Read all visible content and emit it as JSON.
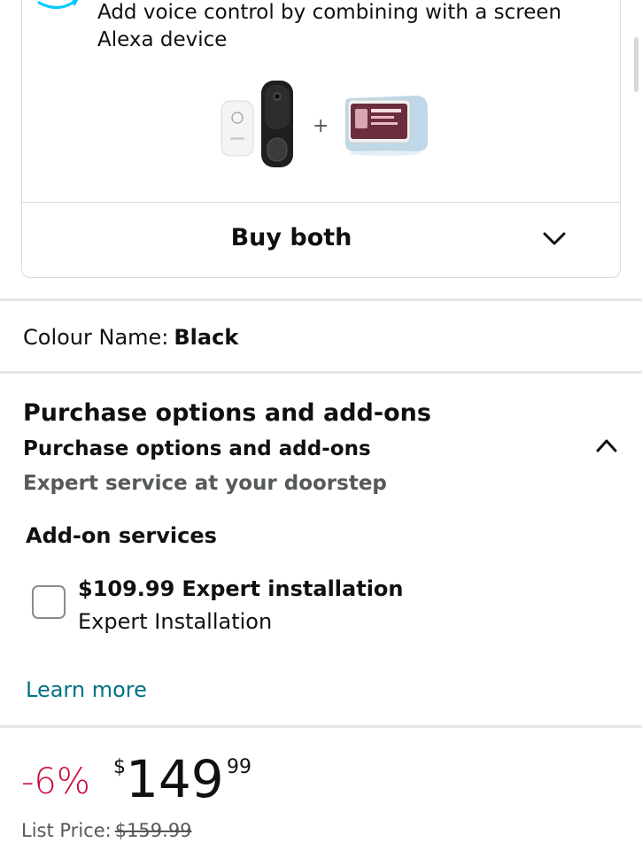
{
  "bundle": {
    "text": "Add voice control by combining with a screen Alexa device",
    "plus_sign": "+",
    "buy_both_label": "Buy both"
  },
  "colour": {
    "label": "Colour Name:",
    "value": "Black"
  },
  "purchase_options": {
    "heading": "Purchase options and add-ons",
    "subheading": "Purchase options and add-ons",
    "tagline": "Expert service at your doorstep",
    "addon_section_title": "Add-on services",
    "addon": {
      "checked": false,
      "price": "$109.99",
      "name": "Expert installation",
      "description": "Expert Installation"
    },
    "learn_more": "Learn more"
  },
  "pricing": {
    "discount": "-6%",
    "currency_symbol": "$",
    "whole": "149",
    "fraction": "99",
    "list_price_label": "List Price:",
    "list_price_value": "$159.99"
  },
  "colors": {
    "discount": "#cc0c39",
    "link": "#007185",
    "alexa_accent": "#00caff",
    "border": "#d5d9d9"
  },
  "icons": [
    "alexa-smile-icon",
    "chevron-down-icon",
    "chevron-up-icon",
    "checkbox-icon"
  ]
}
